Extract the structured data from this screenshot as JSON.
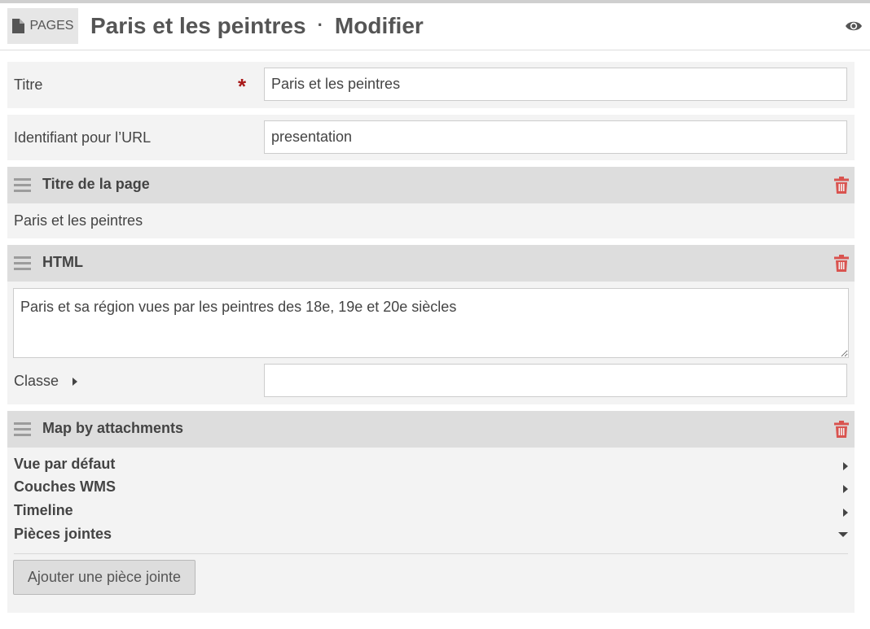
{
  "header": {
    "pages_label": "PAGES",
    "page_title": "Paris et les peintres",
    "separator": "·",
    "mode": "Modifier"
  },
  "form": {
    "title_label": "Titre",
    "title_required_mark": "*",
    "title_value": "Paris et les peintres",
    "slug_label": "Identifiant pour l’URL",
    "slug_value": "presentation"
  },
  "blocks": [
    {
      "title": "Titre de la page",
      "content": "Paris et les peintres"
    },
    {
      "title": "HTML",
      "content": "Paris et sa région vues par les peintres des 18e, 19e et 20e siècles",
      "class_label": "Classe",
      "class_value": ""
    },
    {
      "title": "Map by attachments",
      "sections": [
        {
          "label": "Vue par défaut",
          "state": "collapsed"
        },
        {
          "label": "Couches WMS",
          "state": "collapsed"
        },
        {
          "label": "Timeline",
          "state": "collapsed"
        },
        {
          "label": "Pièces jointes",
          "state": "expanded"
        }
      ],
      "add_button_label": "Ajouter une pièce jointe"
    }
  ],
  "colors": {
    "required": "#a91919",
    "trash": "#d9534f",
    "block_header_bg": "#dddddd",
    "panel_bg": "#f3f3f3"
  },
  "icons": [
    "document-icon",
    "eye-icon",
    "drag-handle-icon",
    "trash-icon",
    "caret-right-icon",
    "caret-down-icon"
  ]
}
